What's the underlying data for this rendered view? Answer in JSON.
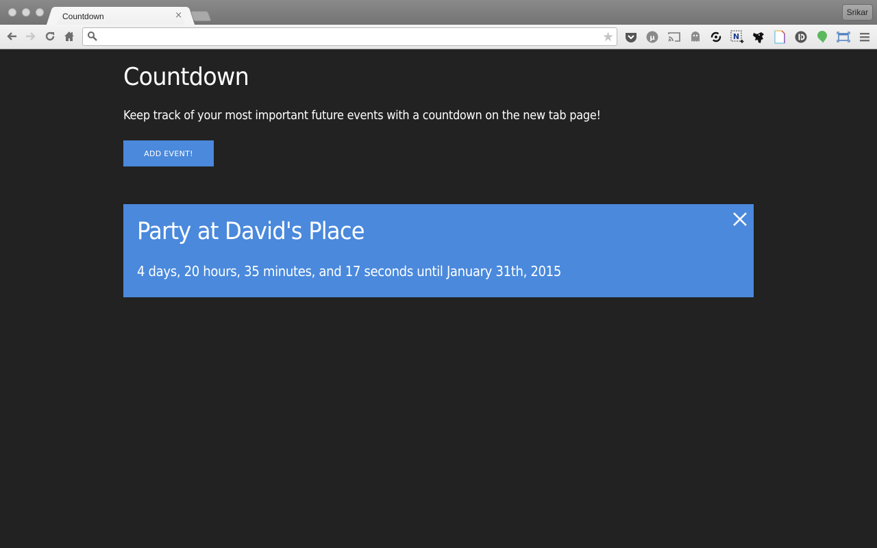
{
  "browser": {
    "tab_title": "Countdown",
    "tab_close": "×",
    "profile_name": "Srikar",
    "address_value": "",
    "address_placeholder": "",
    "extensions": [
      "pocket-icon",
      "utorrent-icon",
      "cast-icon",
      "ghostery-icon",
      "sync-icon",
      "notes-clipper-icon",
      "ninja-icon",
      "document-icon",
      "disconnect-icon",
      "evernote-balloon-icon",
      "screen-capture-icon",
      "menu-icon"
    ]
  },
  "page": {
    "title": "Countdown",
    "description": "Keep track of your most important future events with a countdown on the new tab page!",
    "add_button_label": "ADD EVENT!",
    "accent_color": "#4a89dc",
    "background_color": "#222222",
    "events": [
      {
        "title": "Party at David's Place",
        "countdown": "4 days, 20 hours, 35 minutes, and 17 seconds until January 31th, 2015"
      }
    ]
  }
}
